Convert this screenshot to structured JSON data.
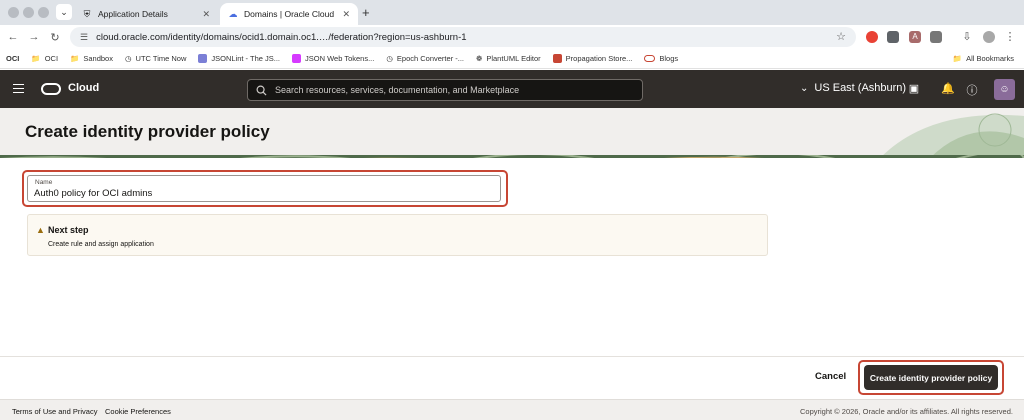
{
  "browser": {
    "tabs": [
      {
        "title": "Application Details",
        "active": false
      },
      {
        "title": "Domains | Oracle Cloud Infras",
        "active": true
      }
    ],
    "url": "cloud.oracle.com/identity/domains/ocid1.domain.oc1.…/federation?region=us-ashburn-1",
    "bookmarks": [
      "OCI",
      "Sandbox",
      "UTC Time Now",
      "JSONLint - The JS...",
      "JSON Web Tokens...",
      "Epoch Converter -...",
      "PlantUML Editor",
      "Propagation Store...",
      "Blogs"
    ],
    "bookmarks_prefix": "OCI",
    "all_bookmarks": "All Bookmarks"
  },
  "header": {
    "brand": "Cloud",
    "search_placeholder": "Search resources, services, documentation, and Marketplace",
    "region": "US East (Ashburn)"
  },
  "page": {
    "title": "Create identity provider policy"
  },
  "form": {
    "name_label": "Name",
    "name_value": "Auth0 policy for OCI admins"
  },
  "next_step": {
    "title": "Next step",
    "description": "Create rule and assign application"
  },
  "actions": {
    "cancel": "Cancel",
    "create": "Create identity provider policy"
  },
  "footer": {
    "terms": "Terms of Use and Privacy",
    "cookies": "Cookie Preferences",
    "copyright": "Copyright © 2026, Oracle and/or its affiliates. All rights reserved."
  },
  "colors": {
    "header_bg": "#312d2a",
    "highlight": "#c74634",
    "page_bg": "#f1efed"
  }
}
